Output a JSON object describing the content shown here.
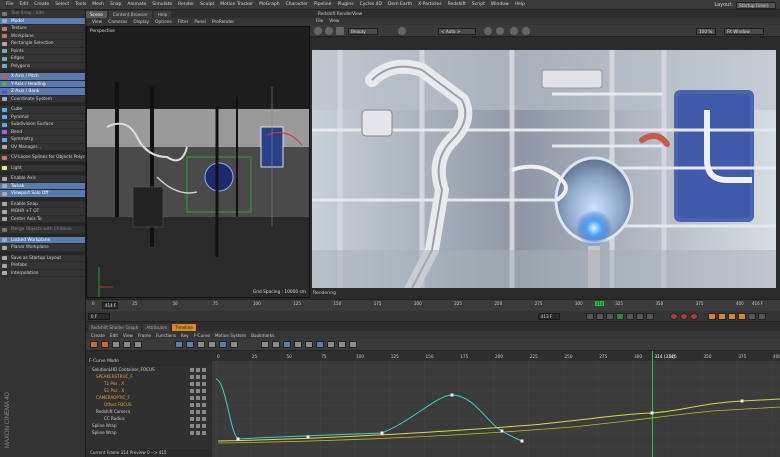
{
  "menubar": {
    "items": [
      "File",
      "Edit",
      "Create",
      "Select",
      "Tools",
      "Mesh",
      "Snap",
      "Animate",
      "Simulate",
      "Render",
      "Sculpt",
      "Motion Tracker",
      "MoGraph",
      "Character",
      "Pipeline",
      "Plugins",
      "Cycles 4D",
      "Dem Earth",
      "X-Particles",
      "Redshift",
      "Script",
      "Window",
      "Help"
    ],
    "layout_label": "Layout:",
    "layout_value": "Startup (User)"
  },
  "palette": {
    "items": [
      {
        "label": "Tool Snap / Edit",
        "hl": false,
        "dim": true,
        "ic": "#777"
      },
      {
        "label": "Model",
        "hl": true,
        "ic": "#9ab"
      },
      {
        "label": "Texture",
        "hl": false,
        "ic": "#c76"
      },
      {
        "label": "Workplane",
        "hl": false,
        "ic": "#c76"
      },
      {
        "label": "Rectangle Selection",
        "hl": false,
        "ic": "#aaa"
      },
      {
        "label": "Points",
        "hl": false,
        "ic": "#7ab"
      },
      {
        "label": "Edges",
        "hl": false,
        "ic": "#7ab"
      },
      {
        "label": "Polygons",
        "hl": false,
        "ic": "#7ab"
      },
      {
        "label": "",
        "sep": true
      },
      {
        "label": "X-Axis / Pitch",
        "hl": true,
        "ic": "#c55"
      },
      {
        "label": "Y-Axis / Heading",
        "hl": true,
        "ic": "#5a5"
      },
      {
        "label": "Z-Axis / Bank",
        "hl": true,
        "ic": "#55c"
      },
      {
        "label": "Coordinate System",
        "hl": false,
        "ic": "#aaa"
      },
      {
        "label": "",
        "sep": true
      },
      {
        "label": "Cube",
        "hl": false,
        "ic": "#6ae"
      },
      {
        "label": "Pyramid",
        "hl": false,
        "ic": "#6ae"
      },
      {
        "label": "Subdivision Surface",
        "hl": false,
        "ic": "#6ae"
      },
      {
        "label": "Bend",
        "hl": false,
        "ic": "#a6e"
      },
      {
        "label": "Symmetry",
        "hl": false,
        "ic": "#6ae"
      },
      {
        "label": "UV Manager...",
        "hl": false,
        "ic": "#aaa"
      },
      {
        "label": "",
        "sep": true
      },
      {
        "label": "CV-Loose Splines for Objects Polys",
        "hl": false,
        "ic": "#c76"
      },
      {
        "label": "",
        "sep": true
      },
      {
        "label": "Light",
        "hl": false,
        "ic": "#ee8"
      },
      {
        "label": "",
        "sep": true
      },
      {
        "label": "Enable Axis",
        "hl": false,
        "ic": "#aaa"
      },
      {
        "label": "Tweak",
        "hl": true,
        "ic": "#aaa"
      },
      {
        "label": "Viewport Solo Off",
        "hl": true,
        "ic": "#aaa"
      },
      {
        "label": "",
        "sep": true
      },
      {
        "label": "Enable Snap",
        "hl": false,
        "ic": "#aaa"
      },
      {
        "label": "MOHR +T OT",
        "hl": false,
        "ic": "#aaa"
      },
      {
        "label": "Center Axis To",
        "hl": false,
        "ic": "#aaa"
      },
      {
        "label": "",
        "sep": true
      },
      {
        "label": "Merge Objects with Children",
        "hl": false,
        "dim": true,
        "ic": "#777"
      },
      {
        "label": "",
        "sep": true
      },
      {
        "label": "Locked Workplane",
        "hl": true,
        "ic": "#aaa"
      },
      {
        "label": "Planar Workplane",
        "hl": false,
        "ic": "#aaa"
      },
      {
        "label": "",
        "sep": true
      },
      {
        "label": "Save as Startup Layout",
        "hl": false,
        "ic": "#aaa"
      },
      {
        "label": "Prefabs",
        "hl": false,
        "ic": "#aaa"
      },
      {
        "label": "Interpolation",
        "hl": false,
        "ic": "#aaa"
      }
    ]
  },
  "viewport": {
    "tabs": [
      "Scene",
      "Content Browser",
      "Help"
    ],
    "menu": [
      "View",
      "Cameras",
      "Display",
      "Options",
      "Filter",
      "Panel",
      "ProRender"
    ],
    "label": "Perspective",
    "grid_spacing": "Grid Spacing : 10000 cm"
  },
  "renderview": {
    "title": "Redshift RenderView",
    "menu": [
      "File",
      "View"
    ],
    "beauty": "Beauty",
    "aovs": "< Auto >",
    "zoom": "100 %",
    "fit": "Fit Window",
    "status": "Rendering"
  },
  "timeline": {
    "ticks": [
      "0",
      "25",
      "50",
      "75",
      "100",
      "125",
      "150",
      "175",
      "200",
      "225",
      "250",
      "275",
      "300",
      "325",
      "350",
      "375",
      "400"
    ],
    "current": "314",
    "end_field": "414 F",
    "start_field": "0 F",
    "frame_field": "413 F",
    "end_marker": "416 F"
  },
  "fcurve": {
    "tabs": [
      "Redshift Shader Graph",
      "Attributes",
      "Timeline"
    ],
    "active_tab": "Timeline",
    "menu": [
      "Create",
      "Edit",
      "View",
      "Frame",
      "Functions",
      "Key",
      "F-Curve",
      "Motion System",
      "Bookmarks"
    ],
    "mode": "F-Curve Mode",
    "ticks": [
      "0",
      "25",
      "50",
      "75",
      "100",
      "125",
      "150",
      "175",
      "200",
      "225",
      "250",
      "275",
      "300",
      "325",
      "350",
      "375",
      "400"
    ],
    "current_label": "314 (314)",
    "tracks": [
      {
        "label": "SolutionLHD Container_FOCUS",
        "orange": false,
        "indent": 6
      },
      {
        "label": "SPEAKERSTRUC_F",
        "orange": true,
        "indent": 10
      },
      {
        "label": "T1 Pos . X",
        "orange": true,
        "indent": 18
      },
      {
        "label": "S1 Pos . X",
        "orange": true,
        "indent": 18
      },
      {
        "label": "CAMERAOPTIC_F",
        "orange": true,
        "indent": 10
      },
      {
        "label": "Offset FOCUS",
        "orange": true,
        "indent": 18
      },
      {
        "label": "Redshift Camera",
        "orange": false,
        "indent": 10
      },
      {
        "label": "CC Radius",
        "orange": false,
        "indent": 18
      },
      {
        "label": "Spline Wrap",
        "orange": false,
        "indent": 6
      },
      {
        "label": "Spline Wrap",
        "orange": false,
        "indent": 6
      }
    ],
    "status": "Current Frame 314  Preview 0 --> 415"
  },
  "colors": {
    "accent": "#5b7bae",
    "timeline_active": "#d88a2a",
    "curve_cyan": "#3fd1c7",
    "curve_yellow": "#d9d84a",
    "playhead": "#27c24a"
  },
  "brand": "MAXON CINEMA 4D"
}
